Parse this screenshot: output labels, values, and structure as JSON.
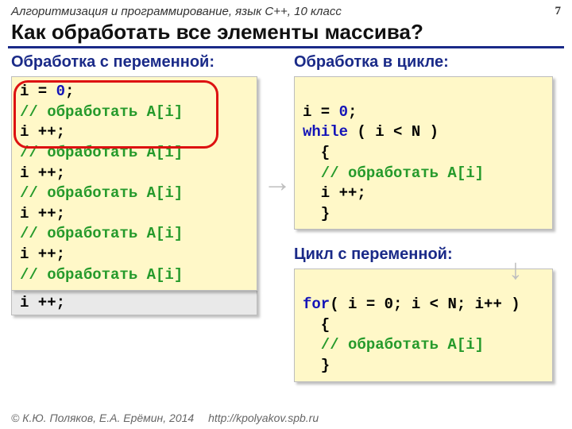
{
  "header": {
    "course": "Алгоритмизация и программирование, язык C++, 10 класс",
    "page": "7"
  },
  "title": "Как обработать все элементы массива?",
  "left": {
    "heading": "Обработка с переменной:",
    "l1a": "i = ",
    "l1b": "0",
    "l1c": ";",
    "c1": "// обработать A[i]",
    "inc": "i ++;",
    "extra": "i ++;"
  },
  "right1": {
    "heading": "Обработка в цикле:",
    "l1a": "i = ",
    "l1b": "0",
    "l1c": ";",
    "l2a": "while",
    "l2b": " ( i < N )",
    "l3": "  {",
    "l4": "  // обработать A[i]",
    "l5": "  i ++;",
    "l6": "  }"
  },
  "right2": {
    "heading": "Цикл с переменной:",
    "l1a": "for",
    "l1b": "( i = 0; i < N; i++ )",
    "l2": "  {",
    "l3": "  // обработать A[i]",
    "l4": "  }"
  },
  "footer": {
    "copy": "© К.Ю. Поляков, Е.А. Ерёмин, 2014",
    "url": "http://kpolyakov.spb.ru"
  }
}
